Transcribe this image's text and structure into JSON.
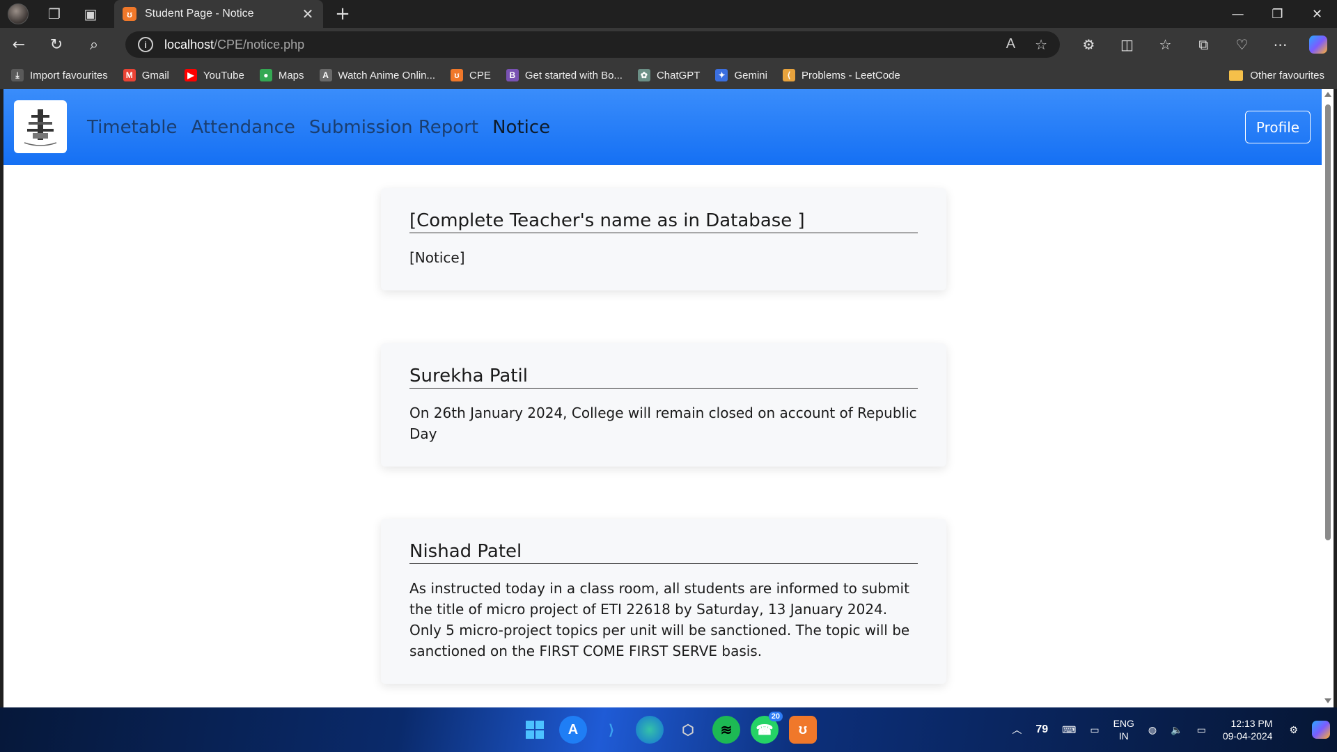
{
  "browser": {
    "tab_title": "Student Page - Notice",
    "tab_favicon_glyph": "ʊ",
    "url_host": "localhost",
    "url_path": "/CPE/notice.php",
    "bookmarks": [
      {
        "label": "Import favourites",
        "icon": "import-icon",
        "color": "#5a5a5a",
        "glyph": "⤓"
      },
      {
        "label": "Gmail",
        "icon": "gmail-icon",
        "color": "#ea4335",
        "glyph": "M"
      },
      {
        "label": "YouTube",
        "icon": "youtube-icon",
        "color": "#ff0000",
        "glyph": "▶"
      },
      {
        "label": "Maps",
        "icon": "maps-icon",
        "color": "#34a853",
        "glyph": "●"
      },
      {
        "label": "Watch Anime Onlin...",
        "icon": "anime-icon",
        "color": "#6a6a6a",
        "glyph": "A"
      },
      {
        "label": "CPE",
        "icon": "xampp-icon",
        "color": "#f0782a",
        "glyph": "ʊ"
      },
      {
        "label": "Get started with Bo...",
        "icon": "bootstrap-icon",
        "color": "#7952b3",
        "glyph": "B"
      },
      {
        "label": "ChatGPT",
        "icon": "chatgpt-icon",
        "color": "#6b8f86",
        "glyph": "✿"
      },
      {
        "label": "Gemini",
        "icon": "gemini-icon",
        "color": "#3b6fe0",
        "glyph": "✦"
      },
      {
        "label": "Problems - LeetCode",
        "icon": "leetcode-icon",
        "color": "#e8a33d",
        "glyph": "⟨"
      }
    ],
    "other_favourites": "Other favourites"
  },
  "site": {
    "nav": [
      "Timetable",
      "Attendance",
      "Submission Report",
      "Notice"
    ],
    "active_nav": "Notice",
    "profile_label": "Profile"
  },
  "notices": [
    {
      "teacher": "[Complete Teacher's name as in Database ]",
      "text": "[Notice]"
    },
    {
      "teacher": "Surekha Patil",
      "text": "On 26th January 2024, College will remain closed on account of Republic Day"
    },
    {
      "teacher": "Nishad Patel",
      "text": "As instructed today in a class room, all students are informed to submit the title of micro project of ETI 22618 by Saturday, 13 January 2024. Only 5 micro-project topics per unit will be sanctioned. The topic will be sanctioned on the FIRST COME FIRST SERVE basis."
    }
  ],
  "taskbar": {
    "whatsapp_badge": "20",
    "tray_number": "79",
    "language": "ENG",
    "region": "IN",
    "time": "12:13 PM",
    "date": "09-04-2024"
  }
}
